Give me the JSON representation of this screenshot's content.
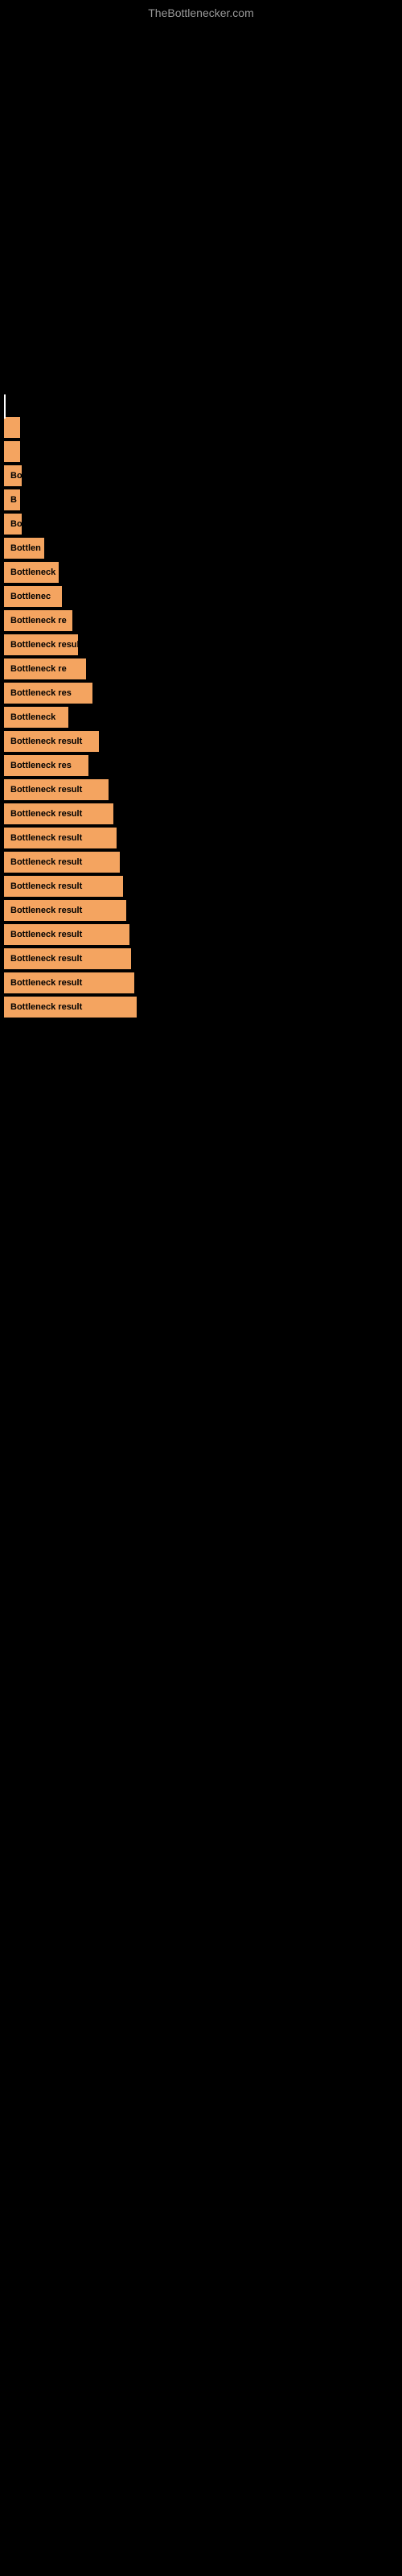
{
  "site": {
    "title": "TheBottlenecker.com"
  },
  "bars": [
    {
      "id": 1,
      "label": "",
      "width_class": "small-bar-1",
      "visible_text": ""
    },
    {
      "id": 2,
      "label": "",
      "width_class": "small-bar-2",
      "visible_text": ""
    },
    {
      "id": 3,
      "label": "Bo",
      "width_class": "small-bar-3",
      "visible_text": "Bo"
    },
    {
      "id": 4,
      "label": "B",
      "width_class": "small-bar-2",
      "visible_text": "B"
    },
    {
      "id": 5,
      "label": "Bo",
      "width_class": "small-bar-3",
      "visible_text": "Bo"
    },
    {
      "id": 6,
      "label": "Bottlen",
      "width_class": "small-bar-4",
      "visible_text": "Bottlen"
    },
    {
      "id": 7,
      "label": "Bottleneck r",
      "width_class": "small-bar-5",
      "visible_text": "Bottleneck r"
    },
    {
      "id": 8,
      "label": "Bottlenec",
      "width_class": "small-bar-6",
      "visible_text": "Bottlenec"
    },
    {
      "id": 9,
      "label": "Bottleneck re",
      "width_class": "small-bar-7",
      "visible_text": "Bottleneck re"
    },
    {
      "id": 10,
      "label": "Bottleneck resul",
      "width_class": "small-bar-8",
      "visible_text": "Bottleneck resul"
    },
    {
      "id": 11,
      "label": "Bottleneck re",
      "width_class": "small-bar-9",
      "visible_text": "Bottleneck re"
    },
    {
      "id": 12,
      "label": "Bottleneck res",
      "width_class": "small-bar-10",
      "visible_text": "Bottleneck res"
    },
    {
      "id": 13,
      "label": "Bottleneck",
      "width_class": "small-bar-11",
      "visible_text": "Bottleneck"
    },
    {
      "id": 14,
      "label": "Bottleneck result",
      "width_class": "small-bar-12",
      "visible_text": "Bottleneck result"
    },
    {
      "id": 15,
      "label": "Bottleneck res",
      "width_class": "small-bar-13",
      "visible_text": "Bottleneck res"
    },
    {
      "id": 16,
      "label": "Bottleneck result",
      "width_class": "small-bar-14",
      "visible_text": "Bottleneck result"
    },
    {
      "id": 17,
      "label": "Bottleneck result",
      "width_class": "small-bar-15",
      "visible_text": "Bottleneck result"
    },
    {
      "id": 18,
      "label": "Bottleneck result",
      "width_class": "small-bar-16",
      "visible_text": "Bottleneck result"
    },
    {
      "id": 19,
      "label": "Bottleneck result",
      "width_class": "small-bar-17",
      "visible_text": "Bottleneck result"
    },
    {
      "id": 20,
      "label": "Bottleneck result",
      "width_class": "small-bar-18",
      "visible_text": "Bottleneck result"
    },
    {
      "id": 21,
      "label": "Bottleneck result",
      "width_class": "small-bar-19",
      "visible_text": "Bottleneck result"
    },
    {
      "id": 22,
      "label": "Bottleneck result",
      "width_class": "small-bar-20",
      "visible_text": "Bottleneck result"
    },
    {
      "id": 23,
      "label": "Bottleneck result",
      "width_class": "small-bar-21",
      "visible_text": "Bottleneck result"
    },
    {
      "id": 24,
      "label": "Bottleneck result",
      "width_class": "small-bar-22",
      "visible_text": "Bottleneck result"
    },
    {
      "id": 25,
      "label": "Bottleneck result",
      "width_class": "small-bar-23",
      "visible_text": "Bottleneck result"
    }
  ]
}
